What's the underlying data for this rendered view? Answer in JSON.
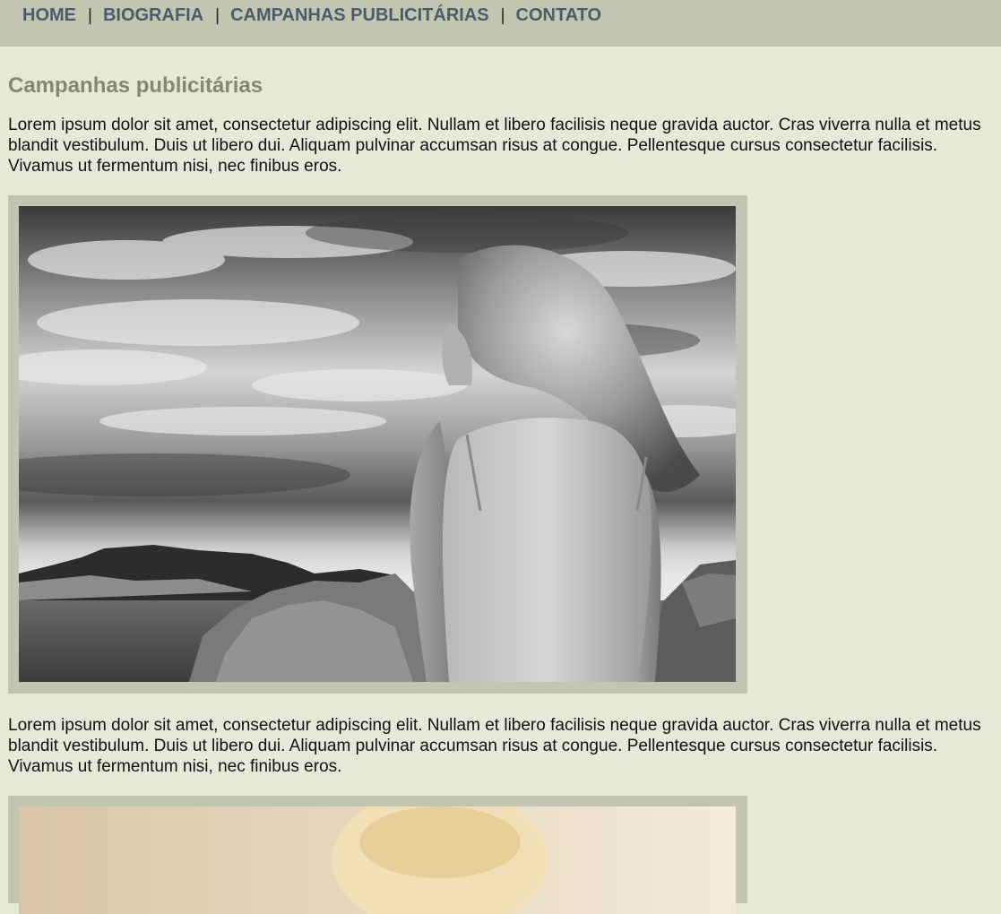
{
  "nav": {
    "items": [
      {
        "label": "HOME"
      },
      {
        "label": "BIOGRAFIA"
      },
      {
        "label": "CAMPANHAS PUBLICITÁRIAS"
      },
      {
        "label": "CONTATO"
      }
    ],
    "separator": "|"
  },
  "main": {
    "title": "Campanhas publicitárias",
    "paragraphs": [
      "Lorem ipsum dolor sit amet, consectetur adipiscing elit. Nullam et libero facilisis neque gravida auctor. Cras viverra nulla et metus blandit vestibulum. Duis ut libero dui. Aliquam pulvinar accumsan risus at congue. Pellentesque cursus consectetur facilisis. Vivamus ut fermentum nisi, nec finibus eros.",
      "Lorem ipsum dolor sit amet, consectetur adipiscing elit. Nullam et libero facilisis neque gravida auctor. Cras viverra nulla et metus blandit vestibulum. Duis ut libero dui. Aliquam pulvinar accumsan risus at congue. Pellentesque cursus consectetur facilisis. Vivamus ut fermentum nisi, nec finibus eros."
    ]
  },
  "colors": {
    "nav_bg": "#c4c5b0",
    "page_bg": "#e6e8d8",
    "nav_text": "#4e5a6c",
    "title_text": "#848676",
    "frame": "#c4c5b0"
  }
}
